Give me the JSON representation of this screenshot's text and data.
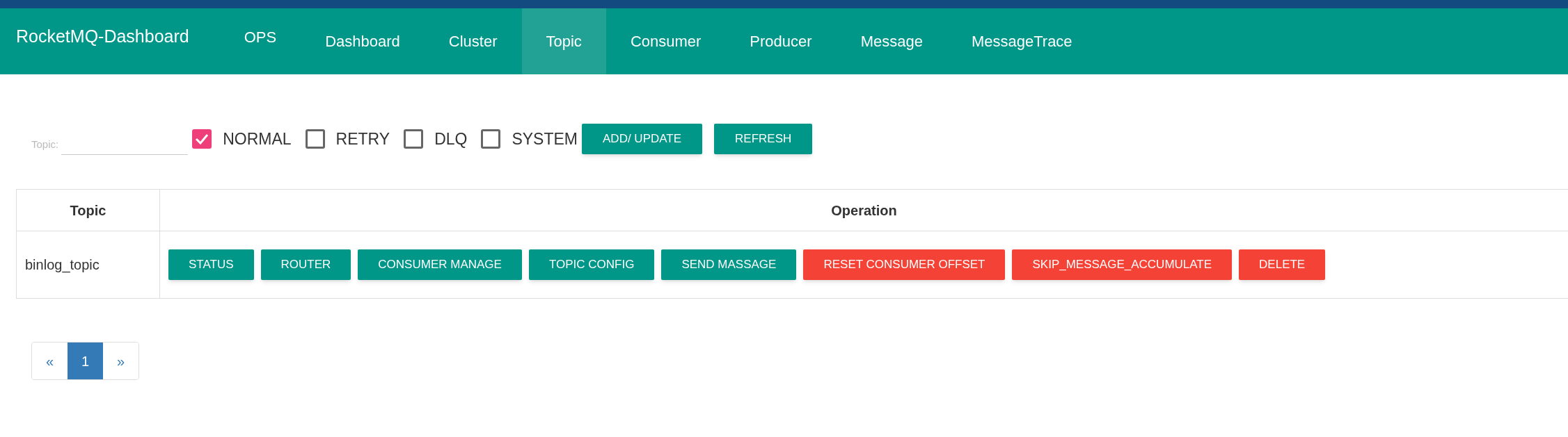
{
  "navbar": {
    "brand": "RocketMQ-Dashboard",
    "items": [
      {
        "label": "OPS",
        "selected": false
      },
      {
        "label": "Dashboard",
        "selected": false
      },
      {
        "label": "Cluster",
        "selected": false
      },
      {
        "label": "Topic",
        "selected": true
      },
      {
        "label": "Consumer",
        "selected": false
      },
      {
        "label": "Producer",
        "selected": false
      },
      {
        "label": "Message",
        "selected": false
      },
      {
        "label": "MessageTrace",
        "selected": false
      }
    ]
  },
  "filter": {
    "topic_field": {
      "label": "Topic:"
    },
    "checkboxes": [
      {
        "label": "NORMAL",
        "checked": true
      },
      {
        "label": "RETRY",
        "checked": false
      },
      {
        "label": "DLQ",
        "checked": false
      },
      {
        "label": "SYSTEM",
        "checked": false
      }
    ],
    "buttons": [
      "ADD/ UPDATE",
      "REFRESH"
    ]
  },
  "table": {
    "columns": [
      "Topic",
      "Operation"
    ],
    "rows": [
      {
        "topic": "binlog_topic",
        "actions": [
          {
            "label": "STATUS",
            "kind": "primary"
          },
          {
            "label": "ROUTER",
            "kind": "primary"
          },
          {
            "label": "CONSUMER MANAGE",
            "kind": "primary"
          },
          {
            "label": "TOPIC CONFIG",
            "kind": "primary"
          },
          {
            "label": "SEND MASSAGE",
            "kind": "primary"
          },
          {
            "label": "RESET CONSUMER OFFSET",
            "kind": "danger"
          },
          {
            "label": "SKIP_MESSAGE_ACCUMULATE",
            "kind": "danger"
          },
          {
            "label": "DELETE",
            "kind": "danger"
          }
        ]
      }
    ]
  },
  "pagination": [
    {
      "label": "«",
      "selected": false
    },
    {
      "label": "1",
      "selected": true
    },
    {
      "label": "»",
      "selected": false
    }
  ]
}
